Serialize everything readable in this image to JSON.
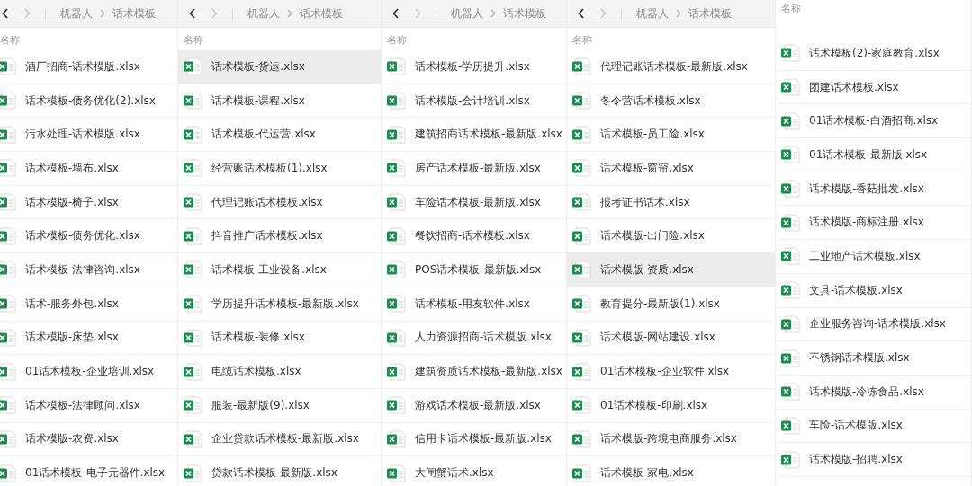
{
  "panels": [
    {
      "toolbar": {
        "breadcrumb": [
          "机器人",
          "话术模板"
        ]
      },
      "column_header": "名称",
      "files": [
        {
          "name": "酒厂招商-话术模版.xlsx",
          "selected": false
        },
        {
          "name": "话术模板-债务优化(2).xlsx",
          "selected": false
        },
        {
          "name": "污水处理-话术模版.xlsx",
          "selected": false
        },
        {
          "name": "话术模板-墙布.xlsx",
          "selected": false
        },
        {
          "name": "话术模版-椅子.xlsx",
          "selected": false
        },
        {
          "name": "话术模板-债务优化.xlsx",
          "selected": false
        },
        {
          "name": "话术模板-法律咨询.xlsx",
          "selected": false
        },
        {
          "name": "话术-服务外包.xlsx",
          "selected": false
        },
        {
          "name": "话术模版-床垫.xlsx",
          "selected": false
        },
        {
          "name": "01话术模板-企业培训.xlsx",
          "selected": false
        },
        {
          "name": "话术模板-法律顾问.xlsx",
          "selected": false
        },
        {
          "name": "话术模版-农资.xlsx",
          "selected": false
        },
        {
          "name": "01话术模板-电子元器件.xlsx",
          "selected": false
        }
      ]
    },
    {
      "toolbar": {
        "breadcrumb": [
          "机器人",
          "话术模板"
        ]
      },
      "column_header": "名称",
      "files": [
        {
          "name": "话术模板-货运.xlsx",
          "selected": true
        },
        {
          "name": "话术模板-课程.xlsx",
          "selected": false
        },
        {
          "name": "话术模板-代运营.xlsx",
          "selected": false
        },
        {
          "name": "经营账话术模板(1).xlsx",
          "selected": false
        },
        {
          "name": "代理记账话术模板.xlsx",
          "selected": false
        },
        {
          "name": "抖音推广话术模板.xlsx",
          "selected": false
        },
        {
          "name": "话术模板-工业设备.xlsx",
          "selected": false
        },
        {
          "name": "学历提升话术模板-最新版.xlsx",
          "selected": false
        },
        {
          "name": "话术模板-装修.xlsx",
          "selected": false
        },
        {
          "name": "电缆话术模板.xlsx",
          "selected": false
        },
        {
          "name": "服装-最新版(9).xlsx",
          "selected": false
        },
        {
          "name": "企业贷款话术模板-最新版.xlsx",
          "selected": false
        },
        {
          "name": "贷款话术模板-最新版.xlsx",
          "selected": false
        }
      ]
    },
    {
      "toolbar": {
        "breadcrumb": [
          "机器人",
          "话术模板"
        ]
      },
      "column_header": "名称",
      "files": [
        {
          "name": "话术模板-学历提升.xlsx",
          "selected": false
        },
        {
          "name": "话术模版-会计培训.xlsx",
          "selected": false
        },
        {
          "name": "建筑招商话术模板-最新版.xlsx",
          "selected": false
        },
        {
          "name": "房产话术模板-最新版.xlsx",
          "selected": false
        },
        {
          "name": "车险话术模板-最新版.xlsx",
          "selected": false
        },
        {
          "name": "餐饮招商-话术模板.xlsx",
          "selected": false
        },
        {
          "name": "POS话术模板-最新版.xlsx",
          "selected": false
        },
        {
          "name": "话术模板-用友软件.xlsx",
          "selected": false
        },
        {
          "name": "人力资源招商-话术模版.xlsx",
          "selected": false
        },
        {
          "name": "建筑资质话术模板-最新版.xlsx",
          "selected": false
        },
        {
          "name": "游戏话术模板-最新版.xlsx",
          "selected": false
        },
        {
          "name": "信用卡话术模板-最新版.xlsx",
          "selected": false
        },
        {
          "name": "大闸蟹话术.xlsx",
          "selected": false
        }
      ]
    },
    {
      "toolbar": {
        "breadcrumb": [
          "机器人",
          "话术模板"
        ]
      },
      "column_header": "名称",
      "files": [
        {
          "name": "代理记账话术模板-最新版.xlsx",
          "selected": false
        },
        {
          "name": "冬令营话术模板.xlsx",
          "selected": false
        },
        {
          "name": "话术模板-员工险.xlsx",
          "selected": false
        },
        {
          "name": "话术模板-窗帘.xlsx",
          "selected": false
        },
        {
          "name": "报考证书话术.xlsx",
          "selected": false
        },
        {
          "name": "话术模版-出门险.xlsx",
          "selected": false
        },
        {
          "name": "话术模版-资质.xlsx",
          "selected": true
        },
        {
          "name": "教育提分-最新版(1).xlsx",
          "selected": false
        },
        {
          "name": "话术模版-网站建设.xlsx",
          "selected": false
        },
        {
          "name": "01话术模板-企业软件.xlsx",
          "selected": false
        },
        {
          "name": "01话术模板-印刷.xlsx",
          "selected": false
        },
        {
          "name": "话术模版-跨境电商服务.xlsx",
          "selected": false
        },
        {
          "name": "话术模板-家电.xlsx",
          "selected": false
        }
      ]
    },
    {
      "column_header": "名称",
      "files": [
        {
          "name": "话术模板(2)-家庭教育.xlsx",
          "selected": false
        },
        {
          "name": "团建话术模板.xlsx",
          "selected": false
        },
        {
          "name": "01话术模板-白酒招商.xlsx",
          "selected": false
        },
        {
          "name": "01话术模板-最新版.xlsx",
          "selected": false
        },
        {
          "name": "话术模版-香菇批发.xlsx",
          "selected": false
        },
        {
          "name": "话术模版-商标注册.xlsx",
          "selected": false
        },
        {
          "name": "工业地产话术模板.xlsx",
          "selected": false
        },
        {
          "name": "文具-话术模板.xlsx",
          "selected": false
        },
        {
          "name": "企业服务咨询-话术模版.xlsx",
          "selected": false
        },
        {
          "name": "不锈钢话术模版.xlsx",
          "selected": false
        },
        {
          "name": "话术模版-冷冻食品.xlsx",
          "selected": false
        },
        {
          "name": "车险-话术模版.xlsx",
          "selected": false
        },
        {
          "name": "话术模版-招聘.xlsx",
          "selected": false
        }
      ]
    }
  ]
}
